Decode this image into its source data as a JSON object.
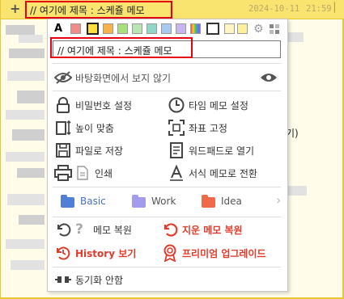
{
  "titlebar": {
    "add_label": "+",
    "title": "// 여기에 제목 : 스케쥴 메모",
    "date": "2024-10-11",
    "time": "21:59",
    "window_control": "✕"
  },
  "background": {
    "partial_text": "기)"
  },
  "popup": {
    "font_label": "A",
    "swatches": [
      "#f08c8c",
      "#fde03c",
      "#f9b24a",
      "#a8e07c",
      "#b8e6b0",
      "#8fd8c8",
      "#a9c8f2",
      "#c8b4ee",
      "#ffffff",
      "#fff6c4",
      "#fff0a0",
      "#ffe680"
    ],
    "title_input_value": "// 여기에 제목 : 스케쥴 메모",
    "hide_wallpaper": "바탕화면에서 보지 않기",
    "password": "비밀번호 설정",
    "timer_memo": "타임 메모 설정",
    "fit_height": "높이 맞춤",
    "fix_position": "좌표 고정",
    "save_file": "파일로 저장",
    "open_wordpad": "워드패드로 열기",
    "print": "인쇄",
    "format_memo": "서식 메모로 전환",
    "folders": [
      {
        "label": "Basic",
        "color": "#4f7fd6",
        "text_color": "#4a6fc4"
      },
      {
        "label": "Work",
        "color": "#a39bec",
        "text_color": "#555555"
      },
      {
        "label": "Idea",
        "color": "#f06a4a",
        "text_color": "#555555"
      }
    ],
    "folder_more": "›",
    "restore_memo": "메모 복원",
    "restore_deleted": "지운 메모 복원",
    "history": "History 보기",
    "premium_upgrade": "프리미엄 업그레이드",
    "sync_off": "동기화 안함"
  }
}
